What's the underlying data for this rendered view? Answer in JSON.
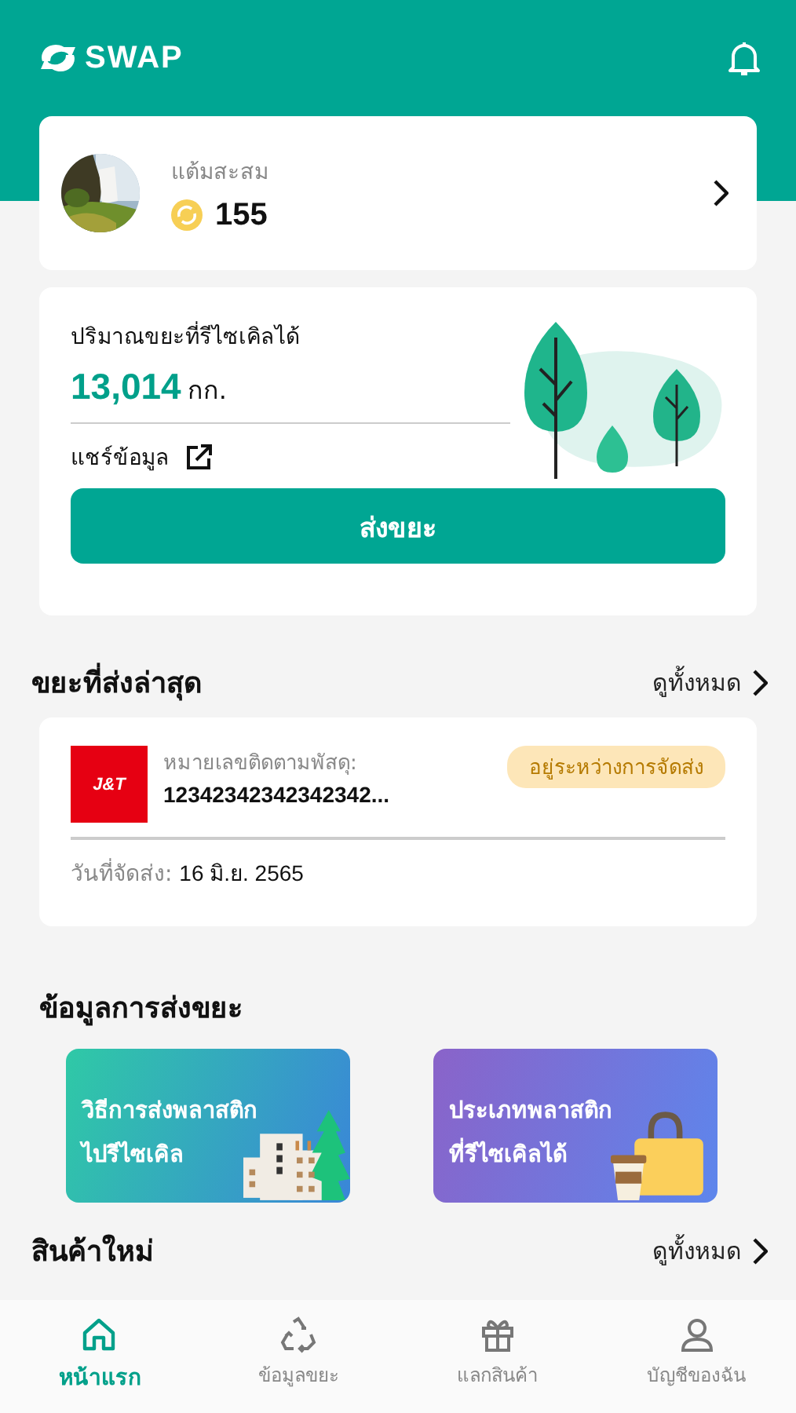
{
  "app_bar": {
    "logo_text": "SWAP"
  },
  "points_card": {
    "label": "แต้มสะสม",
    "points": "155"
  },
  "recycle_card": {
    "title": "ปริมาณขยะที่รีไซเคิลได้",
    "amount": "13,014",
    "unit": "กก.",
    "share_label": "แชร์ข้อมูล",
    "button": "ส่งขยะ"
  },
  "latest_section": {
    "title": "ขยะที่ส่งล่าสุด",
    "see_all": "ดูทั้งหมด"
  },
  "shipment": {
    "carrier_logo": "J&T",
    "tracking_label": "หมายเลขติดตามพัสดุ:",
    "tracking_number": "12342342342342342...",
    "status": "อยู่ระหว่างการจัดส่ง",
    "date_label": "วันที่จัดส่ง:",
    "date": "16 มิ.ย. 2565"
  },
  "info_section": {
    "title": "ข้อมูลการส่งขยะ",
    "tiles": [
      {
        "kind": "building",
        "title_lines": [
          "วิธีการส่งพลาสติก",
          "ไปรีไซเคิล"
        ]
      },
      {
        "kind": "bag",
        "title_lines": [
          "ประเภทพลาสติก",
          "ที่รีไซเคิลได้"
        ]
      }
    ]
  },
  "products_section": {
    "title": "สินค้าใหม่",
    "see_all": "ดูทั้งหมด"
  },
  "bottom_nav": [
    {
      "label": "หน้าแรก",
      "selected": true
    },
    {
      "label": "ข้อมูลขยะ",
      "selected": false
    },
    {
      "label": "แลกสินค้า",
      "selected": false
    },
    {
      "label": "บัญชีของฉัน",
      "selected": false
    }
  ]
}
